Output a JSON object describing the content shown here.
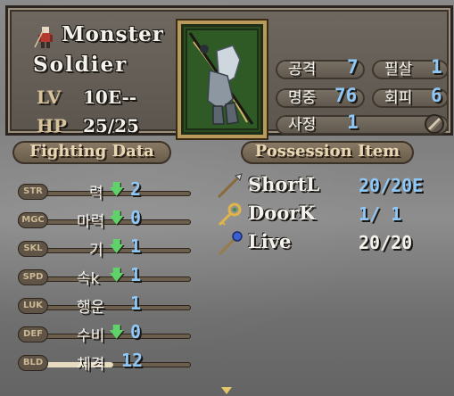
{
  "header": {
    "unit_name": "Monster",
    "unit_class": "Soldier",
    "level_key": "LV",
    "level_value": "10E--",
    "hp_key": "HP",
    "hp_value": "25/25",
    "stats": [
      {
        "label": "공격",
        "value": "7"
      },
      {
        "label": "필살",
        "value": "1"
      },
      {
        "label": "명중",
        "value": "76"
      },
      {
        "label": "회피",
        "value": "6"
      },
      {
        "label": "사정",
        "value": "1"
      }
    ]
  },
  "fighting": {
    "title": "Fighting Data",
    "stats": [
      {
        "abbr": "STR",
        "label": "력",
        "value": "2",
        "arrow": "down",
        "fill_fraction": 0.1
      },
      {
        "abbr": "MGC",
        "label": "마력",
        "value": "0",
        "arrow": "down",
        "fill_fraction": 0.0
      },
      {
        "abbr": "SKL",
        "label": "기",
        "value": "1",
        "arrow": "down",
        "fill_fraction": 0.05
      },
      {
        "abbr": "SPD",
        "label": "속k",
        "value": "1",
        "arrow": "down",
        "fill_fraction": 0.05
      },
      {
        "abbr": "LUK",
        "label": "행운",
        "value": "1",
        "arrow": "",
        "fill_fraction": 0.05
      },
      {
        "abbr": "DEF",
        "label": "수비",
        "value": "0",
        "arrow": "down",
        "fill_fraction": 0.0
      },
      {
        "abbr": "BLD",
        "label": "체격",
        "value": "12",
        "arrow": "",
        "fill_fraction": 0.55
      }
    ],
    "arrow_glyph": "🡇"
  },
  "items": {
    "title": "Possession Item",
    "list": [
      {
        "name": "ShortL",
        "uses": "20/20E",
        "icon": "spear-icon",
        "color": "#8fc7f7"
      },
      {
        "name": "DoorK",
        "uses": "1/ 1",
        "icon": "key-icon",
        "color": "#8fc7f7"
      },
      {
        "name": "Live",
        "uses": "20/20",
        "icon": "staff-icon",
        "color": "#f4f2ec"
      }
    ]
  },
  "colors": {
    "stat_value": "#8fc7f7",
    "stat_label": "#d9c39a",
    "down_arrow": "#5fd36a",
    "panel": "#5b554e",
    "portrait_bg": "#2d4a22"
  }
}
